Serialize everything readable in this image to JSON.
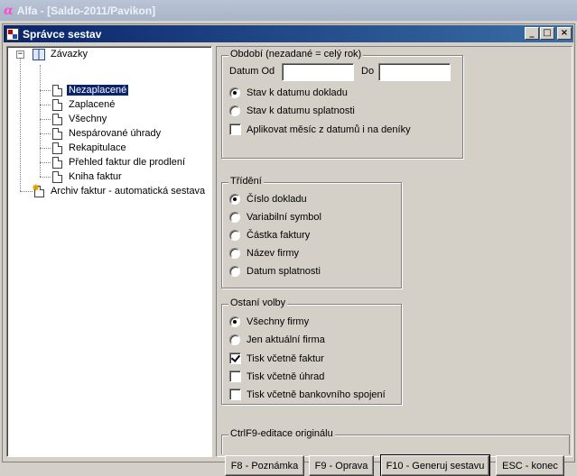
{
  "outer_window": {
    "title": "Alfa - [Saldo-2011/Pavikon]",
    "logo": "α"
  },
  "window": {
    "title": "Správce sestav",
    "buttons": {
      "minimize": "_",
      "maximize": "□",
      "close": "×"
    }
  },
  "tree": {
    "root": {
      "label": "Závazky",
      "expander": "−",
      "icon": "book-icon"
    },
    "children": [
      {
        "label": "Nezaplacené",
        "selected": true
      },
      {
        "label": "Zaplacené"
      },
      {
        "label": "Všechny"
      },
      {
        "label": "Nespárované úhrady"
      },
      {
        "label": "Rekapitulace"
      },
      {
        "label": "Přehled faktur dle prodlení"
      },
      {
        "label": "Kniha faktur"
      }
    ],
    "archive": {
      "label": "Archiv faktur - automatická sestava",
      "icon": "star-document-icon"
    }
  },
  "period": {
    "legend": "Období   (nezadané = celý rok)",
    "date_from_label": "Datum Od",
    "date_from_value": "",
    "date_to_label": "Do",
    "date_to_value": "",
    "options": [
      {
        "label": "Stav k datumu dokladu",
        "checked": true
      },
      {
        "label": "Stav k datumu splatnosti",
        "checked": false
      }
    ],
    "apply_month": {
      "label": "Aplikovat měsíc z datumů i na deníky",
      "checked": false
    }
  },
  "sorting": {
    "legend": "Třídění",
    "options": [
      {
        "label": "Číslo dokladu",
        "checked": true
      },
      {
        "label": "Variabilní symbol",
        "checked": false
      },
      {
        "label": "Částka faktury",
        "checked": false
      },
      {
        "label": "Název firmy",
        "checked": false
      },
      {
        "label": "Datum splatnosti",
        "checked": false
      }
    ]
  },
  "other": {
    "legend": "Ostaní volby",
    "radios": [
      {
        "label": "Všechny firmy",
        "checked": true
      },
      {
        "label": "Jen aktuální firma",
        "checked": false
      }
    ],
    "checks": [
      {
        "label": "Tisk včetně faktur",
        "checked": true
      },
      {
        "label": "Tisk včetně úhrad",
        "checked": false
      },
      {
        "label": "Tisk včetně bankovního spojení",
        "checked": false
      }
    ]
  },
  "actions": {
    "legend": "CtrlF9-editace originálu",
    "f8": "F8 - Poznámka",
    "f9": "F9 - Oprava",
    "f10": "F10 - Generuj sestavu",
    "esc": "ESC - konec"
  }
}
